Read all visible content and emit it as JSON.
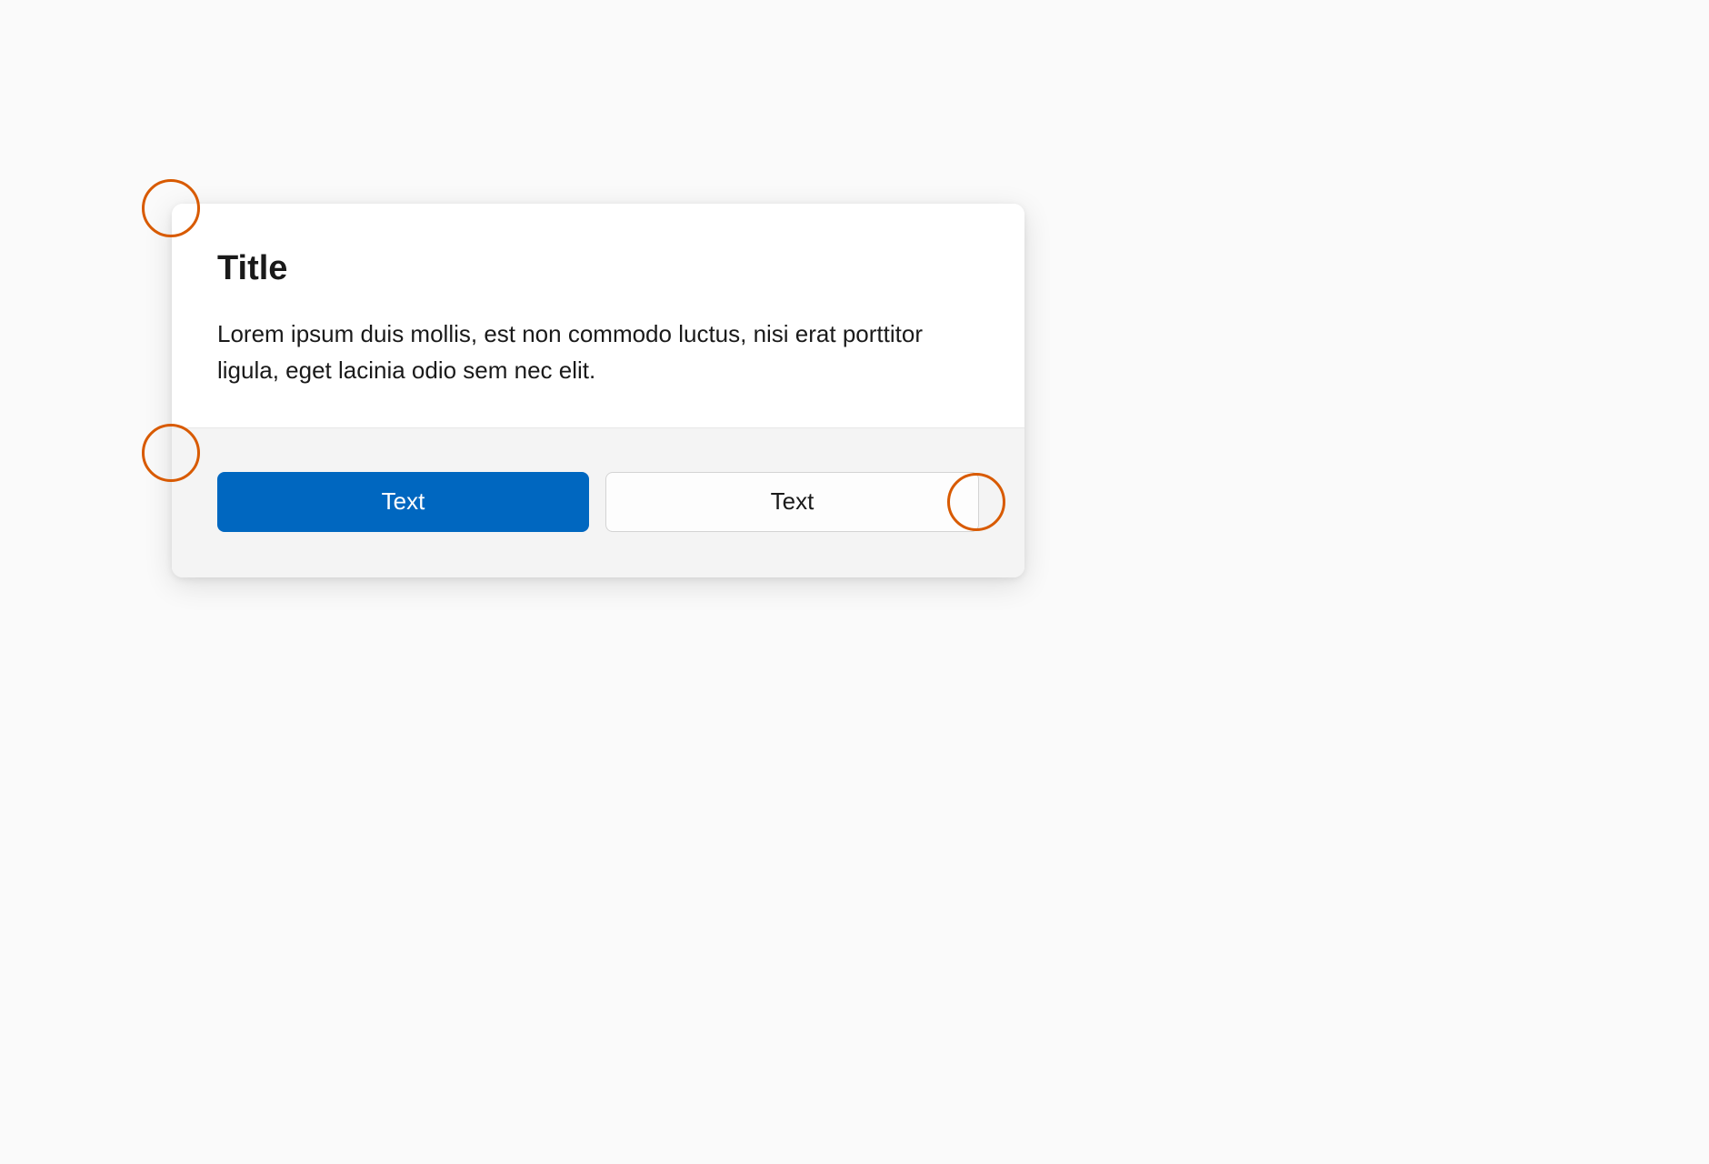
{
  "dialog": {
    "title": "Title",
    "body": "Lorem ipsum duis mollis, est non commodo luctus, nisi erat porttitor ligula, eget lacinia odio sem nec elit.",
    "primary_button": "Text",
    "secondary_button": "Text"
  },
  "colors": {
    "accent": "#0067c0",
    "annotation": "#d85a00"
  }
}
